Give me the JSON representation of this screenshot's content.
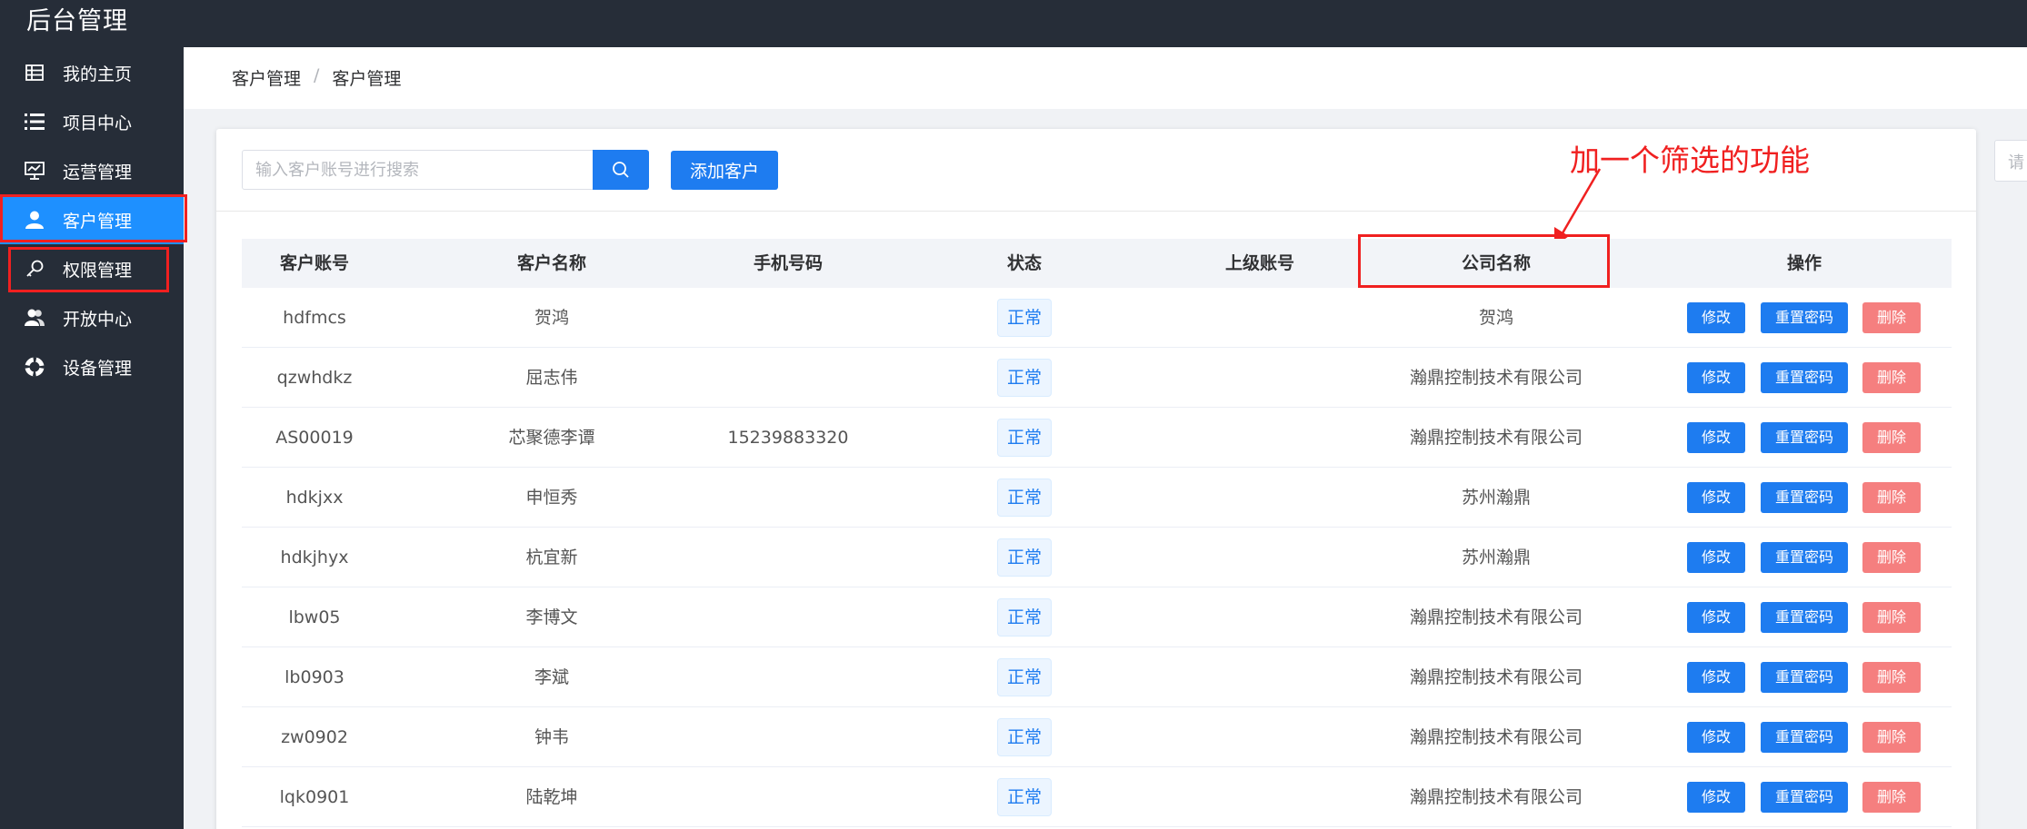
{
  "app": {
    "title": "后台管理"
  },
  "sidebar": {
    "items": [
      {
        "label": "我的主页",
        "icon": "grid-icon"
      },
      {
        "label": "项目中心",
        "icon": "list-icon"
      },
      {
        "label": "运营管理",
        "icon": "monitor-chart-icon"
      },
      {
        "label": "客户管理",
        "icon": "user-icon",
        "active": true
      },
      {
        "label": "权限管理",
        "icon": "key-icon"
      },
      {
        "label": "开放中心",
        "icon": "users-icon"
      },
      {
        "label": "设备管理",
        "icon": "lifebuoy-icon"
      }
    ]
  },
  "breadcrumb": {
    "first": "客户管理",
    "separator": "/",
    "second": "客户管理"
  },
  "toolbar": {
    "search_placeholder": "输入客户账号进行搜索",
    "add_label": "添加客户"
  },
  "right_panel": {
    "placeholder": "请"
  },
  "annotation": {
    "text": "加一个筛选的功能"
  },
  "table": {
    "columns": [
      "客户账号",
      "客户名称",
      "手机号码",
      "状态",
      "上级账号",
      "公司名称",
      "操作"
    ],
    "rows": [
      {
        "account": "hdfmcs",
        "name": "贺鸿",
        "phone": "",
        "status": "正常",
        "parent": "",
        "company": "贺鸿"
      },
      {
        "account": "qzwhdkz",
        "name": "屈志伟",
        "phone": "",
        "status": "正常",
        "parent": "",
        "company": "瀚鼎控制技术有限公司"
      },
      {
        "account": "AS00019",
        "name": "芯聚德李谭",
        "phone": "15239883320",
        "status": "正常",
        "parent": "",
        "company": "瀚鼎控制技术有限公司"
      },
      {
        "account": "hdkjxx",
        "name": "申恒秀",
        "phone": "",
        "status": "正常",
        "parent": "",
        "company": "苏州瀚鼎"
      },
      {
        "account": "hdkjhyx",
        "name": "杭宜新",
        "phone": "",
        "status": "正常",
        "parent": "",
        "company": "苏州瀚鼎"
      },
      {
        "account": "lbw05",
        "name": "李博文",
        "phone": "",
        "status": "正常",
        "parent": "",
        "company": "瀚鼎控制技术有限公司"
      },
      {
        "account": "lb0903",
        "name": "李斌",
        "phone": "",
        "status": "正常",
        "parent": "",
        "company": "瀚鼎控制技术有限公司"
      },
      {
        "account": "zw0902",
        "name": "钟韦",
        "phone": "",
        "status": "正常",
        "parent": "",
        "company": "瀚鼎控制技术有限公司"
      },
      {
        "account": "lqk0901",
        "name": "陆乾坤",
        "phone": "",
        "status": "正常",
        "parent": "",
        "company": "瀚鼎控制技术有限公司"
      }
    ],
    "actions": {
      "edit": "修改",
      "reset": "重置密码",
      "delete": "删除"
    }
  },
  "colors": {
    "sidebar_bg": "#262d38",
    "accent": "#1e7cf0",
    "danger": "#f57f7f",
    "highlight": "#f02020"
  }
}
